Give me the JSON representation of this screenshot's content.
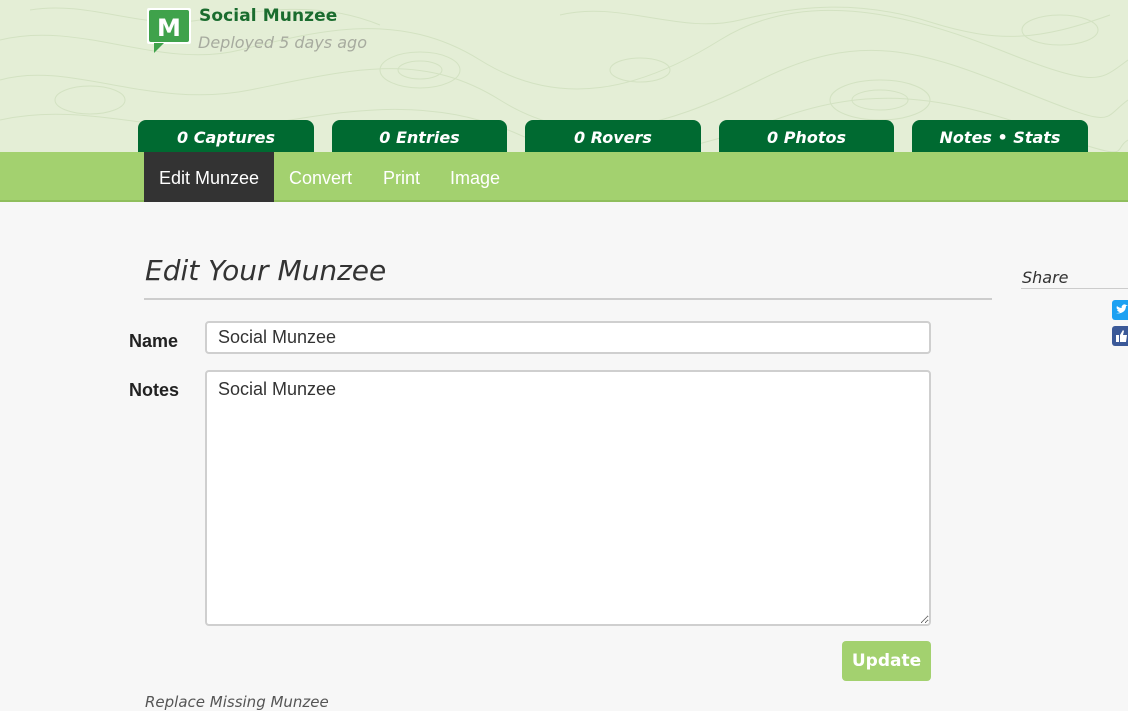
{
  "munzee": {
    "title": "Social Munzee",
    "subtitle": "Deployed 5 days ago",
    "logo_letter": "M"
  },
  "stat_tabs": [
    {
      "label": "0 Captures"
    },
    {
      "label": "0 Entries"
    },
    {
      "label": "0 Rovers"
    },
    {
      "label": "0 Photos"
    },
    {
      "label": "Notes • Stats"
    }
  ],
  "nav": [
    {
      "label": "Edit Munzee",
      "active": true
    },
    {
      "label": "Convert"
    },
    {
      "label": "Print"
    },
    {
      "label": "Image"
    }
  ],
  "form": {
    "heading": "Edit Your Munzee",
    "name_label": "Name",
    "name_value": "Social Munzee",
    "notes_label": "Notes",
    "notes_value": "Social Munzee",
    "update_label": "Update"
  },
  "footer": {
    "replace_link": "Replace Missing Munzee"
  },
  "share": {
    "label": "Share",
    "buttons": [
      {
        "icon": "twitter-icon",
        "color": "#1da1f2"
      },
      {
        "icon": "facebook-like-icon",
        "color": "#3b5998"
      }
    ]
  },
  "colors": {
    "brand_dark_green": "#006a31",
    "nav_green": "#a3d16f",
    "header_bg": "#e4eed6",
    "active_nav": "#333333"
  }
}
